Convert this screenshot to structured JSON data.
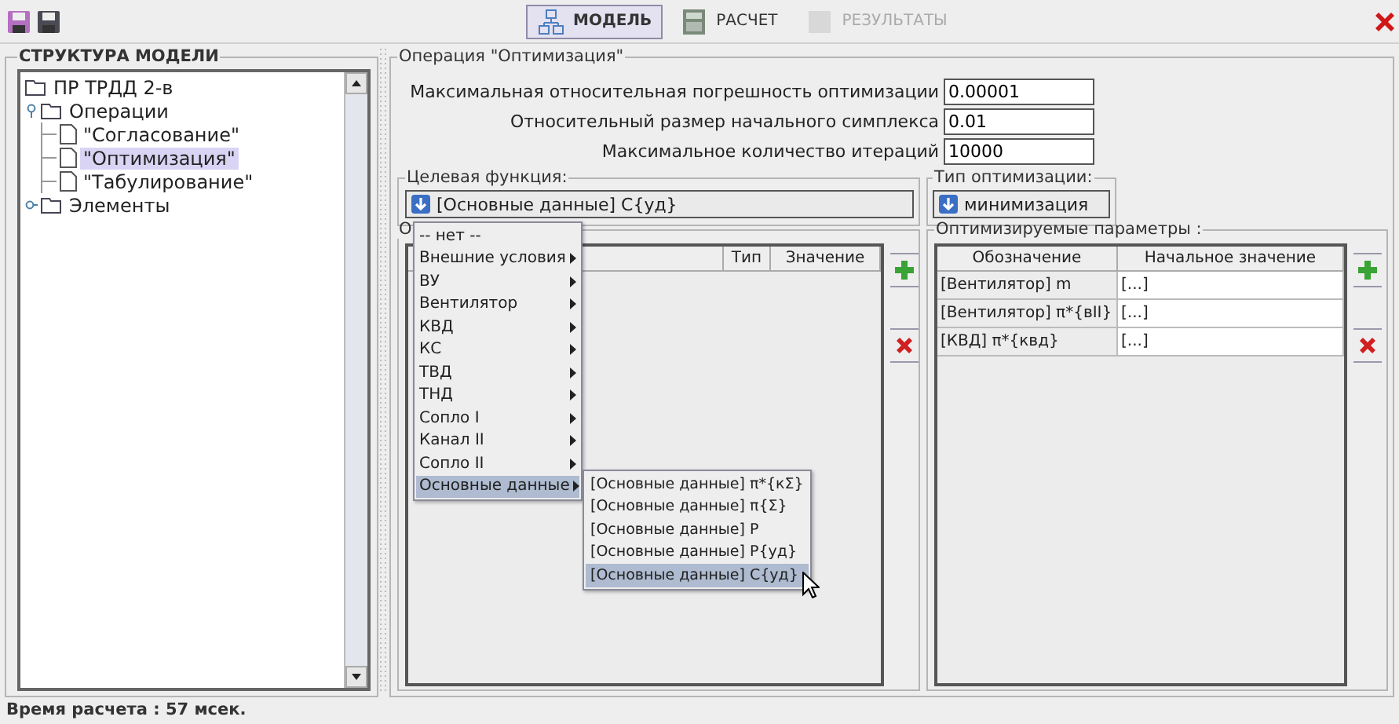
{
  "toolbar": {
    "tabs": [
      {
        "label": "МОДЕЛЬ",
        "kind": "model",
        "selected": true,
        "disabled": false
      },
      {
        "label": "РАСЧЕТ",
        "kind": "calc",
        "selected": false,
        "disabled": false
      },
      {
        "label": "РЕЗУЛЬТАТЫ",
        "kind": "results",
        "selected": false,
        "disabled": true
      }
    ]
  },
  "model_structure": {
    "title": "СТРУКТУРА МОДЕЛИ",
    "tree": [
      {
        "label": "ПР ТРДД 2-в",
        "kind": "folder",
        "selected": false,
        "children": [
          {
            "label": "Операции",
            "kind": "folder",
            "expanded": true,
            "selected": false,
            "children": [
              {
                "label": "\"Согласование\"",
                "kind": "document",
                "selected": false
              },
              {
                "label": "\"Оптимизация\"",
                "kind": "document",
                "selected": true
              },
              {
                "label": "\"Табулирование\"",
                "kind": "document",
                "selected": false
              }
            ]
          },
          {
            "label": "Элементы",
            "kind": "folder",
            "expanded": false,
            "selected": false
          }
        ]
      }
    ]
  },
  "operation": {
    "title": "Операция \"Оптимизация\"",
    "settings": [
      {
        "label": "Максимальная относительная погрешность оптимизации",
        "value": "0.00001"
      },
      {
        "label": "Относительный размер начального симплекса",
        "value": "0.01"
      },
      {
        "label": "Максимальное количество итераций",
        "value": "10000"
      }
    ],
    "target_function": {
      "title": "Целевая функция:",
      "value": "[Основные данные] C{уд}"
    },
    "optimization_type": {
      "title": "Тип оптимизации:",
      "value": "минимизация"
    },
    "constraints": {
      "title": "О",
      "columns": [
        "Тип",
        "Значение"
      ]
    },
    "optimized_parameters": {
      "title": "Оптимизируемые параметры :",
      "columns": [
        "Обозначение",
        "Начальное значение"
      ],
      "rows": [
        {
          "designation": "[Вентилятор] m",
          "initial_value": "[...]"
        },
        {
          "designation": "[Вентилятор] π*{вII}",
          "initial_value": "[...]"
        },
        {
          "designation": "[КВД] π*{квд}",
          "initial_value": "[...]"
        }
      ]
    }
  },
  "popup_menu": {
    "items": [
      {
        "label": "-- нет --",
        "kind": "plain",
        "selected": false
      },
      {
        "label": "Внешние условия",
        "kind": "submenu",
        "selected": false
      },
      {
        "label": "ВУ",
        "kind": "submenu",
        "selected": false
      },
      {
        "label": "Вентилятор",
        "kind": "submenu",
        "selected": false
      },
      {
        "label": "КВД",
        "kind": "submenu",
        "selected": false
      },
      {
        "label": "КС",
        "kind": "submenu",
        "selected": false
      },
      {
        "label": "ТВД",
        "kind": "submenu",
        "selected": false
      },
      {
        "label": "ТНД",
        "kind": "submenu",
        "selected": false
      },
      {
        "label": "Сопло I",
        "kind": "submenu",
        "selected": false
      },
      {
        "label": "Канал II",
        "kind": "submenu",
        "selected": false
      },
      {
        "label": "Сопло II",
        "kind": "submenu",
        "selected": false
      },
      {
        "label": "Основные данные",
        "kind": "submenu",
        "selected": true
      }
    ],
    "submenu": {
      "items": [
        {
          "label": "[Основные данные] π*{кΣ}",
          "selected": false
        },
        {
          "label": "[Основные данные] π{Σ}",
          "selected": false
        },
        {
          "label": "[Основные данные] P",
          "selected": false
        },
        {
          "label": "[Основные данные] P{уд}",
          "selected": false
        },
        {
          "label": "[Основные данные] C{уд}",
          "selected": true
        }
      ]
    }
  },
  "status_bar": {
    "text": "Время расчета : 57 мсек."
  }
}
